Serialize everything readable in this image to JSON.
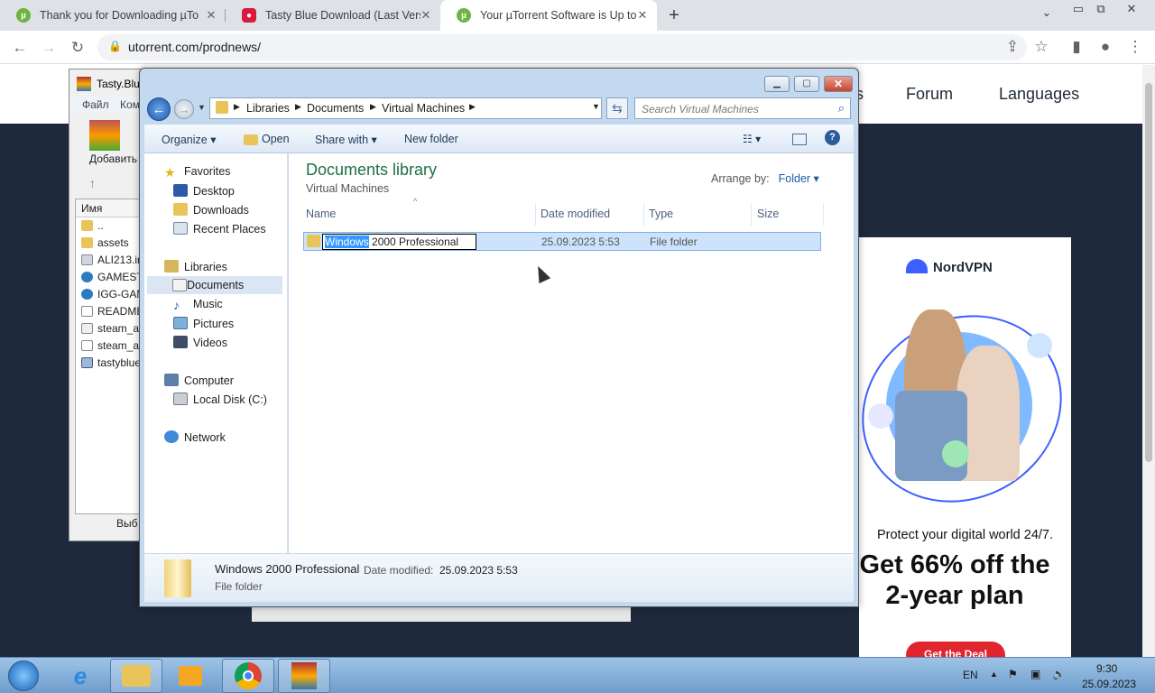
{
  "browser": {
    "tabs": [
      {
        "title": "Thank you for Downloading µTorr"
      },
      {
        "title": "Tasty Blue Download (Last Versio"
      },
      {
        "title": "Your µTorrent Software is Up to D"
      }
    ],
    "url": "utorrent.com/prodnews/"
  },
  "site": {
    "nav": [
      "s",
      "Forum",
      "Languages"
    ]
  },
  "ad": {
    "brand": "NordVPN",
    "line1": "Protect your digital world 24/7.",
    "headline": "Get 66% off the 2-year plan",
    "cta": "Get the Deal"
  },
  "winrar": {
    "title": "Tasty.Blu",
    "menu": [
      "Файл",
      "Ком"
    ],
    "add_label": "Добавить",
    "col_name": "Имя",
    "files": [
      "..",
      "assets",
      "ALI213.in",
      "GAMEST",
      "IGG-GAM",
      "README",
      "steam_ap",
      "steam_ap",
      "tastyblue"
    ],
    "status": "Выб"
  },
  "explorer": {
    "path": [
      "Libraries",
      "Documents",
      "Virtual Machines"
    ],
    "search_placeholder": "Search Virtual Machines",
    "commands": {
      "organize": "Organize ▾",
      "open": "Open",
      "share": "Share with ▾",
      "new_folder": "New folder"
    },
    "nav": {
      "favorites": "Favorites",
      "desktop": "Desktop",
      "downloads": "Downloads",
      "recent": "Recent Places",
      "libraries": "Libraries",
      "documents": "Documents",
      "music": "Music",
      "pictures": "Pictures",
      "videos": "Videos",
      "computer": "Computer",
      "local_disk": "Local Disk (C:)",
      "network": "Network"
    },
    "library_title": "Documents library",
    "library_sub": "Virtual Machines",
    "arrange_label": "Arrange by:",
    "arrange_value": "Folder ▾",
    "columns": {
      "name": "Name",
      "date": "Date modified",
      "type": "Type",
      "size": "Size"
    },
    "file": {
      "name_selected": "Windows",
      "name_rest": " 2000 Professional",
      "date": "25.09.2023 5:53",
      "type": "File folder"
    },
    "details": {
      "name": "Windows 2000 Professional",
      "date_label": "Date modified:",
      "date": "25.09.2023 5:53",
      "type": "File folder"
    }
  },
  "taskbar": {
    "lang": "EN",
    "time": "9:30",
    "date": "25.09.2023"
  }
}
